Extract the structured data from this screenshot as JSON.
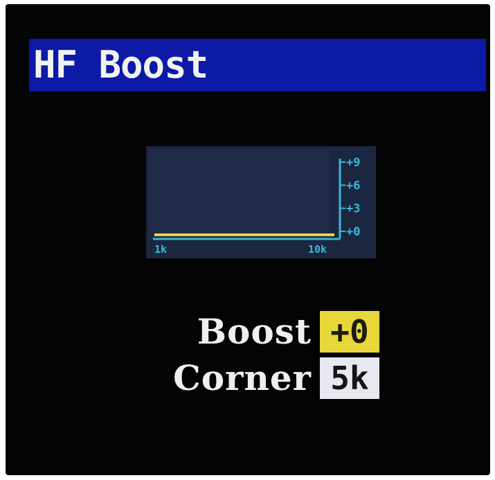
{
  "screen": {
    "title": "HF Boost"
  },
  "graph": {
    "db_ticks": [
      "+9",
      "+6",
      "+3",
      "+0"
    ],
    "freq_low_label": "1k",
    "freq_high_label": "10k",
    "boost_db": 0,
    "colors": {
      "background": "#1b2640",
      "curve": "#e6d640",
      "axis": "#38b8d8"
    }
  },
  "params": [
    {
      "label": "Boost",
      "value": "+0",
      "selected": true
    },
    {
      "label": "Corner",
      "value": "5k",
      "selected": false
    }
  ],
  "colors": {
    "title_bar": "#0c1aa6",
    "selected_value_bg": "#e8d73a",
    "value_bg": "#e8e8f0"
  }
}
